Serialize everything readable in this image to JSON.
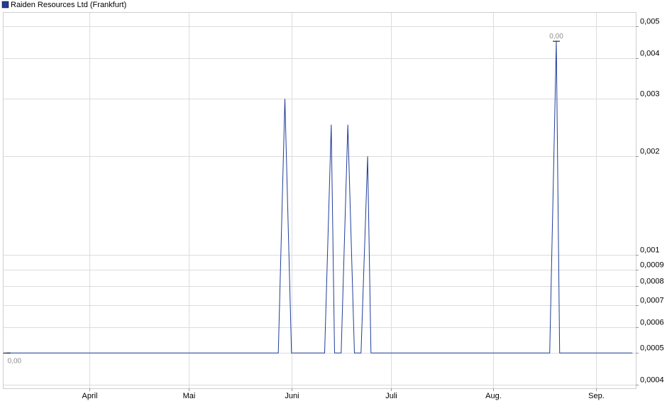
{
  "chart_data": {
    "type": "line",
    "legend": {
      "label": "Raiden Resources Ltd (Frankfurt)",
      "placement": "top-left",
      "color": "#1f3d99"
    },
    "line_color": "#1f3d99",
    "grid": true,
    "y_scale": "log",
    "ylim": [
      0.00039,
      0.0055
    ],
    "y_ticks": [
      {
        "value": 0.0004,
        "label": "0,0004"
      },
      {
        "value": 0.0005,
        "label": "0,0005"
      },
      {
        "value": 0.0006,
        "label": "0,0006"
      },
      {
        "value": 0.0007,
        "label": "0,0007"
      },
      {
        "value": 0.0008,
        "label": "0,0008"
      },
      {
        "value": 0.0009,
        "label": "0,0009"
      },
      {
        "value": 0.001,
        "label": "0,001"
      },
      {
        "value": 0.002,
        "label": "0,002"
      },
      {
        "value": 0.003,
        "label": "0,003"
      },
      {
        "value": 0.004,
        "label": "0,004"
      },
      {
        "value": 0.005,
        "label": "0,005"
      }
    ],
    "xlim": [
      "2024-03-06",
      "2024-09-13"
    ],
    "x_ticks": [
      {
        "date": "2024-04-01",
        "label": "April"
      },
      {
        "date": "2024-05-01",
        "label": "Mai"
      },
      {
        "date": "2024-06-01",
        "label": "Juni"
      },
      {
        "date": "2024-07-01",
        "label": "Juli"
      },
      {
        "date": "2024-08-01",
        "label": "Aug."
      },
      {
        "date": "2024-09-01",
        "label": "Sep."
      }
    ],
    "series": [
      {
        "points": [
          {
            "date": "2024-03-07",
            "value": 0.0005
          },
          {
            "date": "2024-05-28",
            "value": 0.0005
          },
          {
            "date": "2024-05-30",
            "value": 0.003
          },
          {
            "date": "2024-06-01",
            "value": 0.0005
          },
          {
            "date": "2024-06-11",
            "value": 0.0005
          },
          {
            "date": "2024-06-13",
            "value": 0.0025
          },
          {
            "date": "2024-06-14",
            "value": 0.0005
          },
          {
            "date": "2024-06-16",
            "value": 0.0005
          },
          {
            "date": "2024-06-18",
            "value": 0.0025
          },
          {
            "date": "2024-06-20",
            "value": 0.0005
          },
          {
            "date": "2024-06-22",
            "value": 0.0005
          },
          {
            "date": "2024-06-24",
            "value": 0.002
          },
          {
            "date": "2024-06-25",
            "value": 0.0005
          },
          {
            "date": "2024-08-18",
            "value": 0.0005
          },
          {
            "date": "2024-08-20",
            "value": 0.0045
          },
          {
            "date": "2024-08-21",
            "value": 0.0005
          },
          {
            "date": "2024-09-12",
            "value": 0.0005
          }
        ]
      }
    ],
    "annotations": [
      {
        "label": "0,00",
        "date": "2024-03-07",
        "value": 0.0005,
        "kind": "min"
      },
      {
        "label": "0,00",
        "date": "2024-08-20",
        "value": 0.0045,
        "kind": "max"
      }
    ]
  }
}
